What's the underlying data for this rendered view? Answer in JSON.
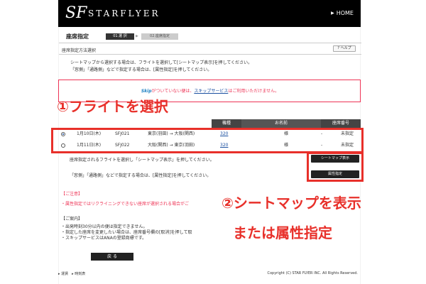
{
  "header": {
    "logo_mark": "SF",
    "logo_text": "STARFLYER",
    "home_label": "HOME"
  },
  "page": {
    "title": "座席指定",
    "steps": [
      "01.選 択",
      "02.座席指定"
    ],
    "section_label": "座席指定方法選択",
    "help_label": "? ヘルプ",
    "desc_line1": "シートマップから選択する場合は、フライトを選択して[シートマップ表示]を押してください。",
    "desc_line2": "「窓側」「通路側」などで指定する場合は、[属性指定]を押してください。"
  },
  "notice": {
    "skip_logo": "Skip",
    "text_before": "がついていない便は、",
    "link": "スキップサービス",
    "text_after": "はご利用いただけません。"
  },
  "annotations": {
    "step1": "①フライトを選択",
    "step2": "②シートマップを表示",
    "step3": "または属性指定"
  },
  "table": {
    "headers": {
      "aircraft": "機種",
      "name": "お名前",
      "seat": "座席番号"
    },
    "rows": [
      {
        "date": "1月10日(木)",
        "flight": "SFJ021",
        "route": "東京(羽田) → 大阪(関西)",
        "aircraft": "320",
        "name": "様",
        "dash": "-",
        "seat": "未指定",
        "selected": true
      },
      {
        "date": "1月11日(木)",
        "flight": "SFJ022",
        "route": "大阪(関西) → 東京(羽田)",
        "aircraft": "320",
        "name": "様",
        "dash": "-",
        "seat": "未指定",
        "selected": false
      }
    ]
  },
  "actions": {
    "instr_seatmap": "座席指定されるフライトを選択し「シートマップ表示」を押してください。",
    "instr_attr": "「窓側」「通路側」などで指定する場合は、[属性指定]を押してください。",
    "seatmap_button": "シートマップ表示",
    "attr_button": "属性指定"
  },
  "caution": {
    "title": "【ご注意】",
    "line": "・属性指定ではリクライニングできない座席が選択される場合がご"
  },
  "guide": {
    "title": "【ご案内】",
    "items": [
      "・出発時刻30分以内の便は指定できません。",
      "・指定した座席を変更したい場合は、座席番号欄の[取消]を押して取",
      "・スキップサービスはANAの登録商標です。"
    ]
  },
  "back_button": "戻 る",
  "footer": {
    "links": "▸ 運賃　▸ 時刻表",
    "copyright": "Copyright (C) STAR FLYER INC. All Rights Reserved."
  },
  "colors": {
    "accent_red": "#e8302a",
    "header_black": "#000000",
    "link_blue": "#1a4fa0"
  }
}
